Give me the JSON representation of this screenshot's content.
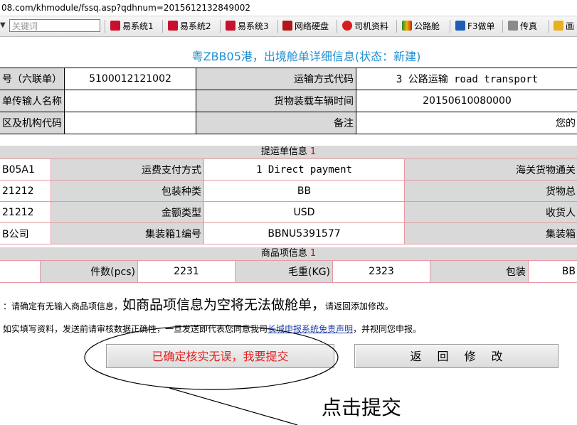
{
  "address_bar": {
    "url": "08.com/khmodule/fssq.asp?qdhnum=2015612132849002"
  },
  "toolbar": {
    "search_placeholder": "关键词",
    "items": [
      {
        "label": "易系统1",
        "icon": "yi-logo-icon"
      },
      {
        "label": "易系统2",
        "icon": "yi-logo-icon"
      },
      {
        "label": "易系统3",
        "icon": "yi-logo-icon"
      },
      {
        "label": "网络硬盘",
        "icon": "k-logo-icon"
      },
      {
        "label": "司机资料",
        "icon": "shield-icon"
      },
      {
        "label": "公路舱",
        "icon": "w-logo-icon"
      },
      {
        "label": "F3做单",
        "icon": "go-logo-icon"
      },
      {
        "label": "传真",
        "icon": "printer-icon"
      },
      {
        "label": "画",
        "icon": "pencil-icon"
      }
    ]
  },
  "page_title": "粤ZBB05港，出境舱单详细信息(状态：新建)",
  "main_info": {
    "rows": [
      {
        "label1": "号（六联单）",
        "value1": "5100012121002",
        "label2": "运输方式代码",
        "value2": "3 公路运输 road transport"
      },
      {
        "label1": "单传输人名称",
        "value1": "",
        "label2": "货物装载车辆时间",
        "value2": "20150610080000"
      },
      {
        "label1": "区及机构代码",
        "value1": "",
        "label2": "备注",
        "value2": "您的"
      }
    ]
  },
  "waybill_section": {
    "title": "提运单信息",
    "count": "1",
    "rows": [
      {
        "c1": "B05A1",
        "label": "运费支付方式",
        "value": "1 Direct payment",
        "right": "海关货物通关"
      },
      {
        "c1": "21212",
        "label": "包装种类",
        "value": "BB",
        "right": "货物总"
      },
      {
        "c1": "21212",
        "label": "金额类型",
        "value": "USD",
        "right": "收货人"
      },
      {
        "c1": "B公司",
        "label": "集装箱1编号",
        "value": "BBNU5391577",
        "right": "集装箱"
      }
    ]
  },
  "goods_section": {
    "title": "商品项信息",
    "count": "1",
    "row": {
      "c1": "",
      "qty_label": "件数(pcs)",
      "qty_value": "2231",
      "weight_label": "毛重(KG)",
      "weight_value": "2323",
      "pack_label": "包装",
      "pack_value": "BB"
    }
  },
  "notes": {
    "line1_a": "：请确定有无输入商品项信息，",
    "line1_big": "如商品项信息为空将无法做舱单，",
    "line1_b": "请返回添加修改。",
    "line2_a": "如实填写资料，发送前请审核数据正确性，一旦发送即代表您同意我司",
    "line2_link": "长城申报系统免责声明",
    "line2_b": "，并视同您申报。"
  },
  "buttons": {
    "confirm": "已确定核实无误，我要提交",
    "back": "返回修改"
  },
  "annotation": {
    "text": "点击提交"
  }
}
